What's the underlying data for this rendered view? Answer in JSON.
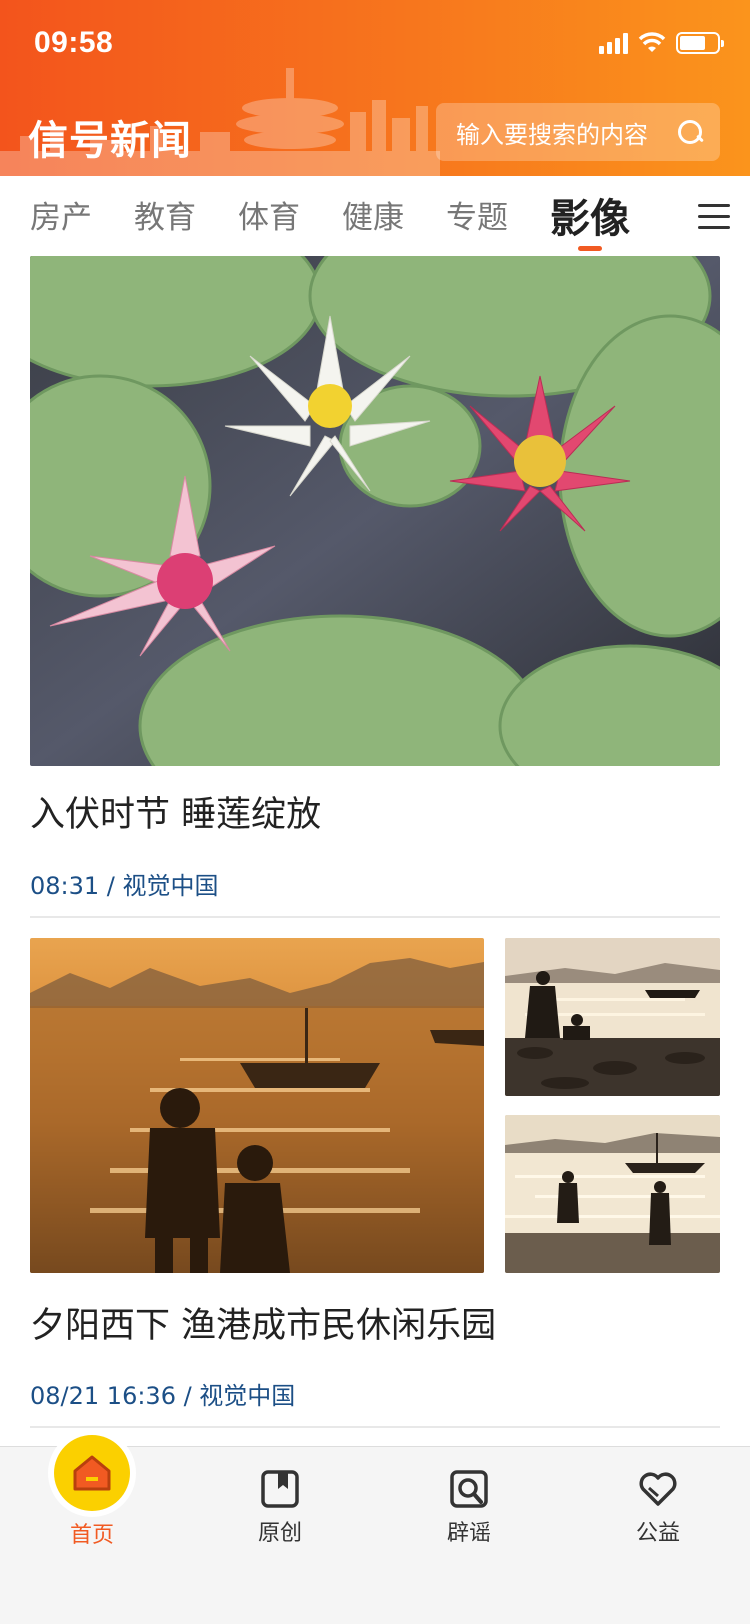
{
  "status_bar": {
    "time": "09:58",
    "battery_level": 0.7
  },
  "header": {
    "logo_text": "信号新闻",
    "search_placeholder": "输入要搜索的内容"
  },
  "tabs": [
    {
      "label": "房产",
      "active": false
    },
    {
      "label": "教育",
      "active": false
    },
    {
      "label": "体育",
      "active": false
    },
    {
      "label": "健康",
      "active": false
    },
    {
      "label": "专题",
      "active": false
    },
    {
      "label": "影像",
      "active": true
    }
  ],
  "feed": [
    {
      "title": "入伏时节 睡莲绽放",
      "meta": "08:31 / 视觉中国",
      "images": [
        "water-lilies-photo"
      ]
    },
    {
      "title": "夕阳西下 渔港成市民休闲乐园",
      "meta": "08/21 16:36 / 视觉中国",
      "images": [
        "sunset-children-photo",
        "beach-clam-digging-photo",
        "beach-wading-photo"
      ]
    }
  ],
  "bottom_nav": [
    {
      "label": "首页",
      "icon": "home-icon",
      "active": true
    },
    {
      "label": "原创",
      "icon": "bookmark-icon",
      "active": false
    },
    {
      "label": "辟谣",
      "icon": "search-doc-icon",
      "active": false
    },
    {
      "label": "公益",
      "icon": "heart-icon",
      "active": false
    }
  ],
  "colors": {
    "brand_start": "#f3541c",
    "brand_end": "#fb941c",
    "meta_text": "#1c4f86",
    "active_tab_underline": "#f15a22",
    "home_circle": "#fbd000"
  }
}
